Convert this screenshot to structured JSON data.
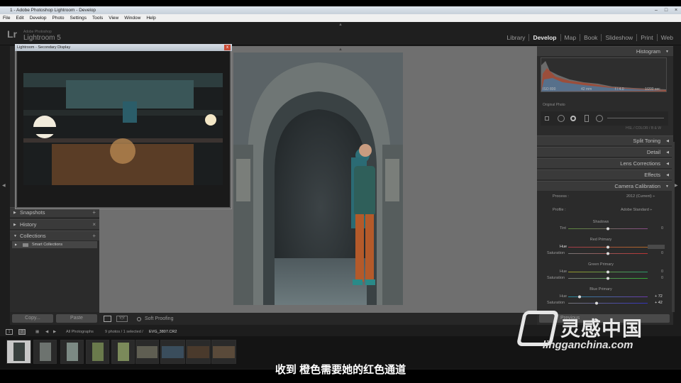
{
  "window": {
    "title": "1 - Adobe Photoshop Lightroom - Develop"
  },
  "menu": [
    "File",
    "Edit",
    "Develop",
    "Photo",
    "Settings",
    "Tools",
    "View",
    "Window",
    "Help"
  ],
  "branding": {
    "logo": "Lr",
    "small": "Adobe Photoshop",
    "name": "Lightroom 5"
  },
  "modules": [
    {
      "label": "Library"
    },
    {
      "label": "Develop",
      "active": true
    },
    {
      "label": "Map"
    },
    {
      "label": "Book"
    },
    {
      "label": "Slideshow"
    },
    {
      "label": "Print"
    },
    {
      "label": "Web"
    }
  ],
  "secondary": {
    "title": "Lightroom - Secondary Display",
    "close": "x"
  },
  "left": {
    "snapshots": "Snapshots",
    "history": "History",
    "history_act": "×",
    "collections": "Collections",
    "collections_act": "+",
    "smart": "Smart Collections",
    "copy": "Copy...",
    "paste": "Paste"
  },
  "toolbar": {
    "soft_proofing": "Soft Proofing"
  },
  "filmbar": {
    "source": "All Photographs",
    "count": "9 photos / 1 selected /",
    "file": "EVG_3807.CR2"
  },
  "right": {
    "histogram": "Histogram",
    "histo_info": {
      "iso": "ISO 800",
      "lens": "42 mm",
      "fstop": "f / 4.0",
      "shutter": "1/200 sec"
    },
    "original": "Original Photo",
    "tabs": "HSL  /  COLOR  /  B & W",
    "split": "Split Toning",
    "detail": "Detail",
    "lens": "Lens Corrections",
    "effects": "Effects",
    "calib": "Camera Calibration",
    "process_label": "Process :",
    "process_val": "2012 (Current) ÷",
    "profile_label": "Profile :",
    "profile_val": "Adobe Standard ÷",
    "shadows": "Shadows",
    "tint": "Tint",
    "red": "Red Primary",
    "green": "Green Primary",
    "blue": "Blue Primary",
    "hue": "Hue",
    "sat": "Saturation",
    "vals": {
      "tint": "0",
      "rhue": "",
      "rsat": "0",
      "ghue": "0",
      "gsat": "0",
      "bhue": "+ 72",
      "bsat": "+ 42"
    },
    "sliders": {
      "tint": 0.5,
      "rhue": 0.5,
      "rsat": 0.5,
      "ghue": 0.5,
      "gsat": 0.5,
      "bhue": 0.14,
      "bsat": 0.36
    },
    "prev": "Previous"
  },
  "subtitle": "收到 橙色需要她的红色通道",
  "watermark": {
    "cn": "灵感中国",
    "url": "lingganchina.com"
  }
}
